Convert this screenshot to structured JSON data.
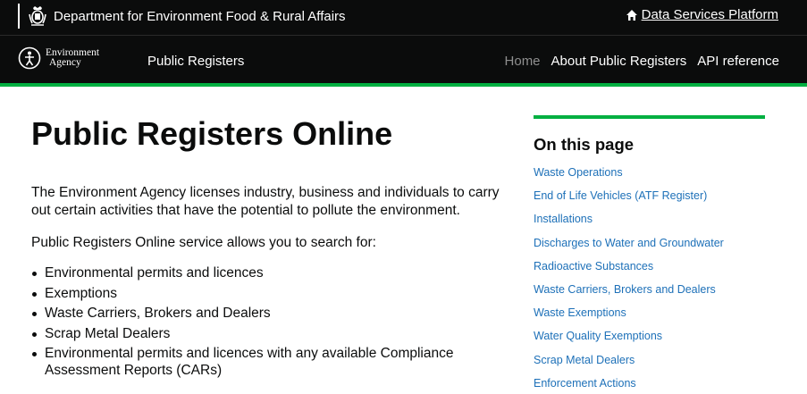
{
  "header": {
    "org_name": "Department for Environment Food & Rural Affairs",
    "data_services_link": "Data Services Platform"
  },
  "navbar": {
    "logo_line1": "Environment",
    "logo_line2": "Agency",
    "service_name": "Public Registers",
    "links": [
      {
        "label": "Home",
        "state": "current"
      },
      {
        "label": "About Public Registers"
      },
      {
        "label": "API reference"
      }
    ]
  },
  "main": {
    "title": "Public Registers Online",
    "intro": "The Environment Agency licenses industry, business and individuals to carry out certain activities that have the potential to pollute the environment.",
    "search_intro": "Public Registers Online service allows you to search for:",
    "search_items": [
      "Environmental permits and licences",
      "Exemptions",
      "Waste Carriers, Brokers and Dealers",
      "Scrap Metal Dealers",
      "Environmental permits and licences with any available Compliance Assessment Reports (CARs)"
    ]
  },
  "aside": {
    "heading": "On this page",
    "links": [
      "Waste Operations",
      "End of Life Vehicles (ATF Register)",
      "Installations",
      "Discharges to Water and Groundwater",
      "Radioactive Substances",
      "Waste Carriers, Brokers and Dealers",
      "Waste Exemptions",
      "Water Quality Exemptions",
      "Scrap Metal Dealers",
      "Enforcement Actions"
    ]
  },
  "colors": {
    "header_bg": "#0b0c0c",
    "accent_green": "#00af41",
    "link_blue": "#1d70b8",
    "muted_nav": "#8f8f8f"
  },
  "icons": [
    "royal-crest-icon",
    "home-icon",
    "environment-agency-logo-icon"
  ]
}
